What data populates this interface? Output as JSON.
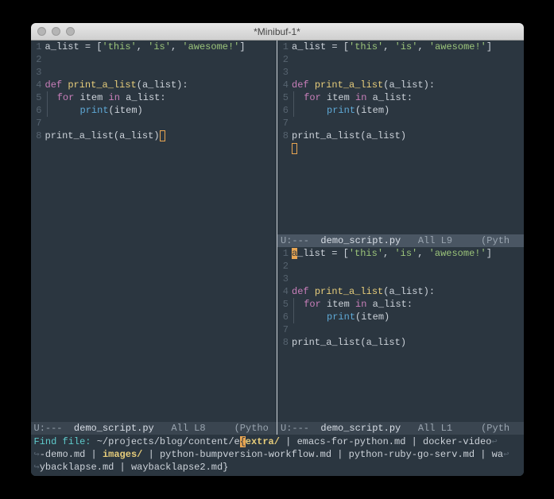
{
  "window": {
    "title": "*Minibuf-1*"
  },
  "code": {
    "lines": [
      {
        "n": 1,
        "tokens": [
          {
            "t": "id",
            "v": "a_list"
          },
          {
            "t": "punct",
            "v": " = ["
          },
          {
            "t": "str",
            "v": "'this'"
          },
          {
            "t": "punct",
            "v": ", "
          },
          {
            "t": "str",
            "v": "'is'"
          },
          {
            "t": "punct",
            "v": ", "
          },
          {
            "t": "str",
            "v": "'awesome!'"
          },
          {
            "t": "punct",
            "v": "]"
          }
        ]
      },
      {
        "n": 2,
        "tokens": []
      },
      {
        "n": 3,
        "tokens": []
      },
      {
        "n": 4,
        "tokens": [
          {
            "t": "kw",
            "v": "def"
          },
          {
            "t": "punct",
            "v": " "
          },
          {
            "t": "fn",
            "v": "print_a_list"
          },
          {
            "t": "punct",
            "v": "("
          },
          {
            "t": "id",
            "v": "a_list"
          },
          {
            "t": "punct",
            "v": "):"
          }
        ]
      },
      {
        "n": 5,
        "tokens": [
          {
            "t": "indent",
            "v": ""
          },
          {
            "t": "kw",
            "v": "for"
          },
          {
            "t": "punct",
            "v": " "
          },
          {
            "t": "id",
            "v": "item"
          },
          {
            "t": "punct",
            "v": " "
          },
          {
            "t": "kw",
            "v": "in"
          },
          {
            "t": "punct",
            "v": " "
          },
          {
            "t": "id",
            "v": "a_list"
          },
          {
            "t": "punct",
            "v": ":"
          }
        ]
      },
      {
        "n": 6,
        "tokens": [
          {
            "t": "indent",
            "v": ""
          },
          {
            "t": "punct",
            "v": "    "
          },
          {
            "t": "builtin",
            "v": "print"
          },
          {
            "t": "punct",
            "v": "("
          },
          {
            "t": "id",
            "v": "item"
          },
          {
            "t": "punct",
            "v": ")"
          }
        ]
      },
      {
        "n": 7,
        "tokens": []
      },
      {
        "n": 8,
        "tokens": [
          {
            "t": "id",
            "v": "print_a_list"
          },
          {
            "t": "punct",
            "v": "("
          },
          {
            "t": "id",
            "v": "a_list"
          },
          {
            "t": "punct",
            "v": ")"
          }
        ]
      }
    ]
  },
  "modelines": {
    "left": {
      "status": "U:---",
      "file": "demo_script.py",
      "pos": "All L8",
      "mode": "(Pytho"
    },
    "topR": {
      "status": "U:---",
      "file": "demo_script.py",
      "pos": "All L9",
      "mode": "(Pyth"
    },
    "botR": {
      "status": "U:---",
      "file": "demo_script.py",
      "pos": "All L1",
      "mode": "(Pyth"
    }
  },
  "minibuffer": {
    "prompt": "Find file: ",
    "path_prefix": "~/projects/blog/content/e",
    "typed_char": "{",
    "sel": "extra/",
    "completions_line1": " | emacs-for-python.md | docker-video",
    "completions_line2_pre": "-demo.md | ",
    "completions_hl": "images/",
    "completions_line2_post": " | python-bumpversion-workflow.md | python-ruby-go-serv.md | wa",
    "completions_line3": "ybacklapse.md | waybacklapse2.md}",
    "wrap_left": "↪",
    "wrap_right": "↩"
  }
}
